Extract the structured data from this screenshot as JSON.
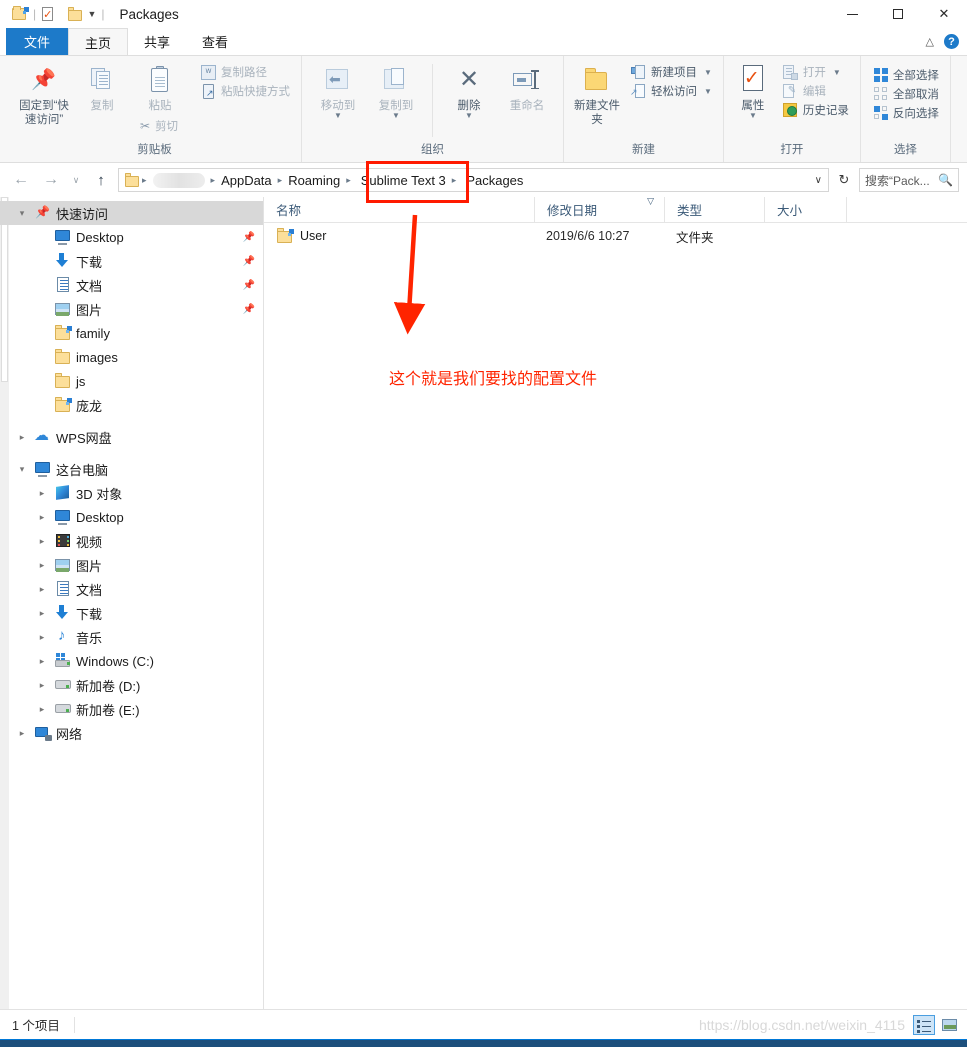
{
  "window": {
    "title": "Packages",
    "quick_access_icons": [
      "new-folder-icon",
      "properties-icon",
      "folder-icon"
    ],
    "controls": {
      "minimize": "—",
      "maximize": "□",
      "close": "✕"
    },
    "help": "?"
  },
  "ribbon_tabs": [
    {
      "label": "文件",
      "name": "tab-file"
    },
    {
      "label": "主页",
      "name": "tab-home"
    },
    {
      "label": "共享",
      "name": "tab-share"
    },
    {
      "label": "查看",
      "name": "tab-view"
    }
  ],
  "ribbon": {
    "groups": [
      {
        "label": "剪贴板",
        "name": "group-clipboard",
        "big": [
          {
            "label": "固定到“快速访问”",
            "icon": "pin-icon",
            "dim": false
          },
          {
            "label": "复制",
            "icon": "copy-icon",
            "dim": true
          },
          {
            "label": "粘贴",
            "icon": "paste-icon",
            "dim": true
          }
        ],
        "small": [
          {
            "label": "复制路径",
            "icon": "copy-path-icon"
          },
          {
            "label": "粘贴快捷方式",
            "icon": "paste-shortcut-icon"
          },
          {
            "label": "剪切",
            "icon": "scissors-icon"
          }
        ]
      },
      {
        "label": "组织",
        "name": "group-organize",
        "big": [
          {
            "label": "移动到",
            "icon": "move-to-icon",
            "dim": true
          },
          {
            "label": "复制到",
            "icon": "copy-to-icon",
            "dim": true
          },
          {
            "label": "删除",
            "icon": "delete-icon",
            "dim": false
          },
          {
            "label": "重命名",
            "icon": "rename-icon",
            "dim": true
          }
        ]
      },
      {
        "label": "新建",
        "name": "group-new",
        "big": [
          {
            "label": "新建文件夹",
            "icon": "new-folder-icon",
            "dim": false
          }
        ],
        "small": [
          {
            "label": "新建项目",
            "icon": "new-item-icon",
            "caret": true
          },
          {
            "label": "轻松访问",
            "icon": "easy-access-icon",
            "caret": true
          }
        ]
      },
      {
        "label": "打开",
        "name": "group-open",
        "big": [
          {
            "label": "属性",
            "icon": "properties-icon",
            "dim": false
          }
        ],
        "small": [
          {
            "label": "打开",
            "icon": "open-icon",
            "caret": true,
            "dim": true
          },
          {
            "label": "编辑",
            "icon": "edit-icon",
            "dim": true
          },
          {
            "label": "历史记录",
            "icon": "history-icon",
            "dim": false
          }
        ]
      },
      {
        "label": "选择",
        "name": "group-select",
        "small": [
          {
            "label": "全部选择",
            "icon": "select-all-icon"
          },
          {
            "label": "全部取消",
            "icon": "select-none-icon"
          },
          {
            "label": "反向选择",
            "icon": "invert-selection-icon"
          }
        ]
      }
    ]
  },
  "addressbar": {
    "back": "←",
    "forward": "→",
    "history_caret": "∨",
    "up": "↑",
    "breadcrumbs": [
      {
        "label": "",
        "icon": "folder-icon",
        "blurred": false
      },
      {
        "label": "",
        "blurred": true
      },
      {
        "label": "AppData",
        "blurred": false
      },
      {
        "label": "Roaming",
        "blurred": false
      },
      {
        "label": "Sublime Text 3",
        "blurred": false,
        "highlighted": true
      },
      {
        "label": "Packages",
        "blurred": false
      }
    ],
    "dropdown_caret": "∨",
    "refresh": "↻",
    "search_placeholder": "搜索“Pack...",
    "search_value": ""
  },
  "sidebar": {
    "items": [
      {
        "label": "快速访问",
        "icon": "quick-access-icon",
        "level": 0,
        "expander": "open",
        "selected": true,
        "pinned": false
      },
      {
        "label": "Desktop",
        "icon": "monitor-icon",
        "level": 1,
        "expander": "none",
        "pinned": true
      },
      {
        "label": "下载",
        "icon": "download-icon",
        "level": 1,
        "expander": "none",
        "pinned": true
      },
      {
        "label": "文档",
        "icon": "documents-icon",
        "level": 1,
        "expander": "none",
        "pinned": true
      },
      {
        "label": "图片",
        "icon": "pictures-icon",
        "level": 1,
        "expander": "none",
        "pinned": true
      },
      {
        "label": "family",
        "icon": "folder-blue-icon",
        "level": 1,
        "expander": "none",
        "pinned": false
      },
      {
        "label": "images",
        "icon": "folder-icon",
        "level": 1,
        "expander": "none",
        "pinned": false
      },
      {
        "label": "js",
        "icon": "folder-icon",
        "level": 1,
        "expander": "none",
        "pinned": false
      },
      {
        "label": "庞龙",
        "icon": "folder-blue-icon",
        "level": 1,
        "expander": "none",
        "pinned": false
      },
      {
        "label": "WPS网盘",
        "icon": "cloud-icon",
        "level": 0,
        "expander": "closed",
        "pinned": false
      },
      {
        "label": "这台电脑",
        "icon": "monitor-icon",
        "level": 0,
        "expander": "open",
        "pinned": false
      },
      {
        "label": "3D 对象",
        "icon": "3d-objects-icon",
        "level": 1,
        "expander": "closed",
        "pinned": false
      },
      {
        "label": "Desktop",
        "icon": "monitor-icon",
        "level": 1,
        "expander": "closed",
        "pinned": false
      },
      {
        "label": "视频",
        "icon": "video-icon",
        "level": 1,
        "expander": "closed",
        "pinned": false
      },
      {
        "label": "图片",
        "icon": "pictures-icon",
        "level": 1,
        "expander": "closed",
        "pinned": false
      },
      {
        "label": "文档",
        "icon": "documents-icon",
        "level": 1,
        "expander": "closed",
        "pinned": false
      },
      {
        "label": "下载",
        "icon": "download-icon",
        "level": 1,
        "expander": "closed",
        "pinned": false
      },
      {
        "label": "音乐",
        "icon": "music-icon",
        "level": 1,
        "expander": "closed",
        "pinned": false
      },
      {
        "label": "Windows (C:)",
        "icon": "windows-drive-icon",
        "level": 1,
        "expander": "closed",
        "pinned": false
      },
      {
        "label": "新加卷 (D:)",
        "icon": "drive-icon",
        "level": 1,
        "expander": "closed",
        "pinned": false
      },
      {
        "label": "新加卷 (E:)",
        "icon": "drive-icon",
        "level": 1,
        "expander": "closed",
        "pinned": false
      },
      {
        "label": "网络",
        "icon": "network-icon",
        "level": 0,
        "expander": "closed",
        "pinned": false
      }
    ]
  },
  "filelist": {
    "columns": [
      {
        "label": "名称",
        "name": "column-name",
        "sorted": false
      },
      {
        "label": "修改日期",
        "name": "column-date-modified",
        "sorted": true
      },
      {
        "label": "类型",
        "name": "column-type",
        "sorted": false
      },
      {
        "label": "大小",
        "name": "column-size",
        "sorted": false
      }
    ],
    "rows": [
      {
        "name": "User",
        "icon": "folder-blue-icon",
        "date": "2019/6/6 10:27",
        "type": "文件夹",
        "size": ""
      }
    ]
  },
  "annotations": {
    "text": "这个就是我们要找的配置文件",
    "color": "#ff2400",
    "box_color": "#ff1a00",
    "box_target": "Sublime Text 3"
  },
  "statusbar": {
    "item_count": "1 个项目",
    "watermark": "https://blog.csdn.net/weixin_4115",
    "views": [
      {
        "name": "details-view-button",
        "active": true
      },
      {
        "name": "large-icons-view-button",
        "active": false
      }
    ]
  }
}
